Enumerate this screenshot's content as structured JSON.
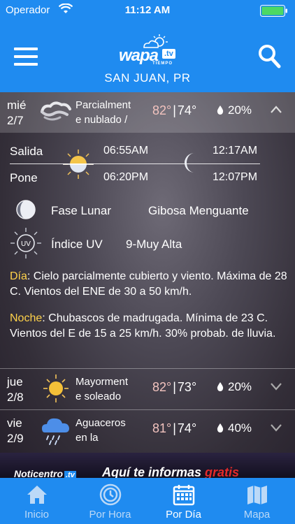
{
  "status": {
    "carrier": "Operador",
    "time": "11:12 AM"
  },
  "header": {
    "logo_word": "wapa",
    "logo_tv": ".tv",
    "logo_sub": "TIEMPO",
    "location": "SAN JUAN, PR"
  },
  "days": [
    {
      "day": "mié",
      "date": "2/7",
      "icon": "wind-cloud-icon",
      "condition_l1": "Parcialment",
      "condition_l2": "e nublado /",
      "hi": "82°",
      "lo": "74°",
      "rain": "20%"
    },
    {
      "day": "jue",
      "date": "2/8",
      "icon": "sun-icon",
      "condition_l1": "Mayorment",
      "condition_l2": "e soleado",
      "hi": "82°",
      "lo": "73°",
      "rain": "20%"
    },
    {
      "day": "vie",
      "date": "2/9",
      "icon": "rain-cloud-icon",
      "condition_l1": "Aguaceros",
      "condition_l2": "en la",
      "hi": "81°",
      "lo": "74°",
      "rain": "40%"
    }
  ],
  "temp_separator": "|",
  "detail": {
    "rise_label": "Salida",
    "set_label": "Pone",
    "sunrise": "06:55AM",
    "sunset": "06:20PM",
    "moonrise": "12:17AM",
    "moonset": "12:07PM",
    "moon_phase_label": "Fase Lunar",
    "moon_phase_value": "Gibosa Menguante",
    "uv_label": "Índice UV",
    "uv_value": "9-Muy Alta",
    "uv_badge": "UV",
    "day_prefix": "Día",
    "day_text": ": Cielo parcialmente cubierto y viento. Máxima de 28 C. Vientos del ENE de 30 a 50 km/h.",
    "night_prefix": "Noche",
    "night_text": ": Chubascos de madrugada. Mínima de 23 C. Vientos del E de 15 a 25 km/h. 30% probab. de lluvia."
  },
  "ad": {
    "brand": "Noticentro",
    "brand_tv": ".tv",
    "slogan": "Aquí te informas ",
    "slogan_accent": "gratis"
  },
  "tabs": [
    {
      "label": "Inicio",
      "icon": "home-icon"
    },
    {
      "label": "Por Hora",
      "icon": "clock-icon"
    },
    {
      "label": "Por Día",
      "icon": "calendar-icon"
    },
    {
      "label": "Mapa",
      "icon": "map-icon"
    }
  ],
  "colors": {
    "brand_blue": "#1f8bf0",
    "high_temp": "#f3c4bf",
    "accent_yellow": "#ffd24a",
    "ad_red": "#e42a2a"
  }
}
